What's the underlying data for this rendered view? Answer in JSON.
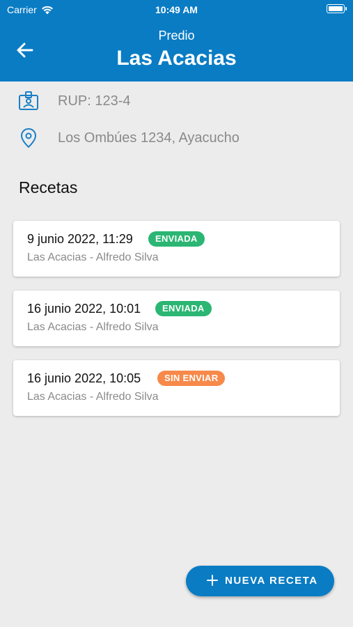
{
  "status_bar": {
    "carrier": "Carrier",
    "time": "10:49 AM"
  },
  "header": {
    "subtitle": "Predio",
    "title": "Las Acacias"
  },
  "info": {
    "rup": "RUP: 123-4",
    "address": "Los Ombúes 1234, Ayacucho"
  },
  "section_title": "Recetas",
  "recetas": [
    {
      "date": "9 junio 2022, 11:29",
      "status": "ENVIADA",
      "status_color": "#2bb673",
      "subtitle": "Las Acacias - Alfredo Silva"
    },
    {
      "date": "16 junio 2022, 10:01",
      "status": "ENVIADA",
      "status_color": "#2bb673",
      "subtitle": "Las Acacias - Alfredo Silva"
    },
    {
      "date": "16 junio 2022, 10:05",
      "status": "SIN ENVIAR",
      "status_color": "#f7894a",
      "subtitle": "Las Acacias - Alfredo Silva"
    }
  ],
  "fab": {
    "label": "NUEVA RECETA"
  },
  "colors": {
    "primary": "#0a7cc4",
    "background": "#ececec",
    "sent": "#2bb673",
    "unsent": "#f7894a"
  }
}
